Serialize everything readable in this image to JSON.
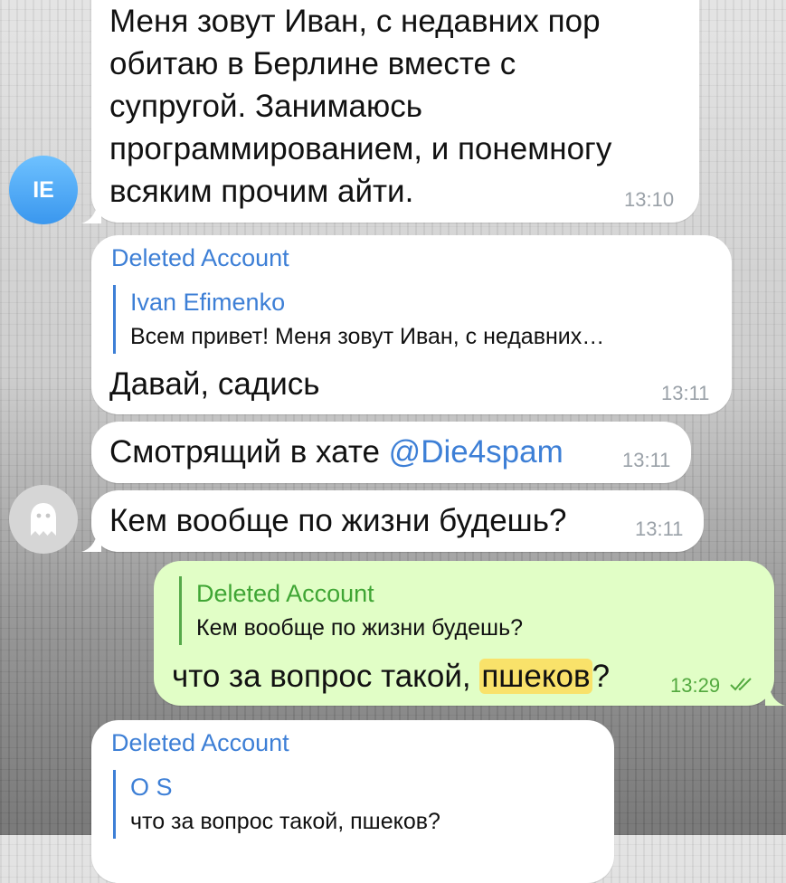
{
  "messages": [
    {
      "text_lines": [
        "Меня зовут Иван, с недавних пор",
        "обитаю в Берлине вместе с",
        "супругой. Занимаюсь",
        "программированием, и понемногу",
        "всяким прочим айти."
      ],
      "time": "13:10"
    },
    {
      "sender": "Deleted Account",
      "reply_name": "Ivan Efimenko",
      "reply_text": "Всем привет! Меня зовут Иван, с недавних…",
      "text": "Давай, садись",
      "time": "13:11"
    },
    {
      "text_prefix": "Смотрящий в хате ",
      "mention": "@Die4spam",
      "time": "13:11"
    },
    {
      "text": "Кем вообще по жизни будешь?",
      "time": "13:11"
    },
    {
      "reply_name": "Deleted Account",
      "reply_text": "Кем вообще по жизни будешь?",
      "text_prefix": "что за вопрос такой, ",
      "text_highlight": "пшеков",
      "text_suffix": "?",
      "time": "13:29",
      "status_icon": "double-check-icon"
    },
    {
      "sender": "Deleted Account",
      "reply_name": "O S",
      "reply_text": "что за вопрос такой, пшеков?"
    }
  ],
  "avatars": {
    "first": "IE",
    "second": "ghost-icon"
  }
}
